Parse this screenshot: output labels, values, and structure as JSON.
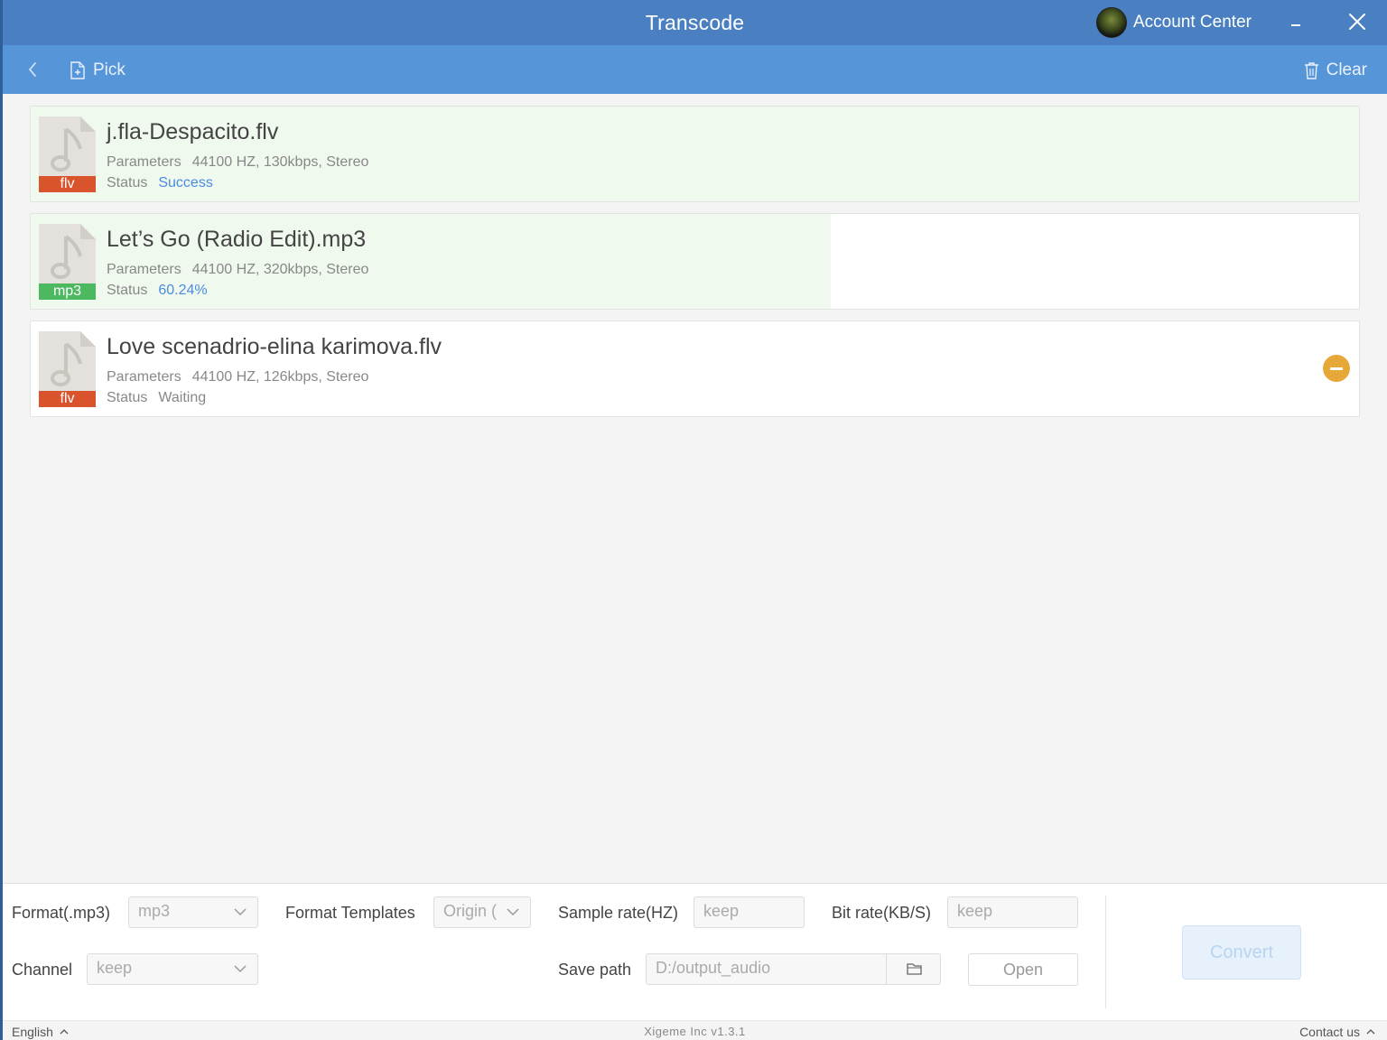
{
  "window": {
    "title": "Transcode",
    "account_label": "Account Center"
  },
  "toolbar": {
    "pick_label": "Pick",
    "clear_label": "Clear"
  },
  "files": [
    {
      "name": "j.fla-Despacito.flv",
      "ext": "flv",
      "badge_color": "#d9532c",
      "parameters_label": "Parameters",
      "parameters": "44100 HZ, 130kbps, Stereo",
      "status_label": "Status",
      "status": "Success",
      "progress": 1.0
    },
    {
      "name": "Let’s Go (Radio Edit).mp3",
      "ext": "mp3",
      "badge_color": "#4cb860",
      "parameters_label": "Parameters",
      "parameters": "44100 HZ, 320kbps, Stereo",
      "status_label": "Status",
      "status": "60.24%",
      "progress": 0.6024
    },
    {
      "name": "Love scenadrio-elina karimova.flv",
      "ext": "flv",
      "badge_color": "#d9532c",
      "parameters_label": "Parameters",
      "parameters": "44100 HZ, 126kbps, Stereo",
      "status_label": "Status",
      "status": "Waiting",
      "progress": 0
    }
  ],
  "settings": {
    "format_label": "Format(.mp3)",
    "format_value": "mp3",
    "templates_label": "Format Templates",
    "templates_value": "Origin (",
    "sample_rate_label": "Sample rate(HZ)",
    "sample_rate_placeholder": "keep",
    "bit_rate_label": "Bit rate(KB/S)",
    "bit_rate_placeholder": "keep",
    "channel_label": "Channel",
    "channel_value": "keep",
    "save_path_label": "Save path",
    "save_path_value": "D:/output_audio",
    "open_label": "Open",
    "convert_label": "Convert"
  },
  "footer": {
    "language": "English",
    "version": "Xigeme Inc v1.3.1",
    "contact": "Contact us"
  },
  "colors": {
    "titlebar": "#4a80c2",
    "toolbar": "#5595d8",
    "progress_fill": "#f0f9ee",
    "status_blue": "#4a8be0",
    "remove_button": "#e7a83a"
  }
}
